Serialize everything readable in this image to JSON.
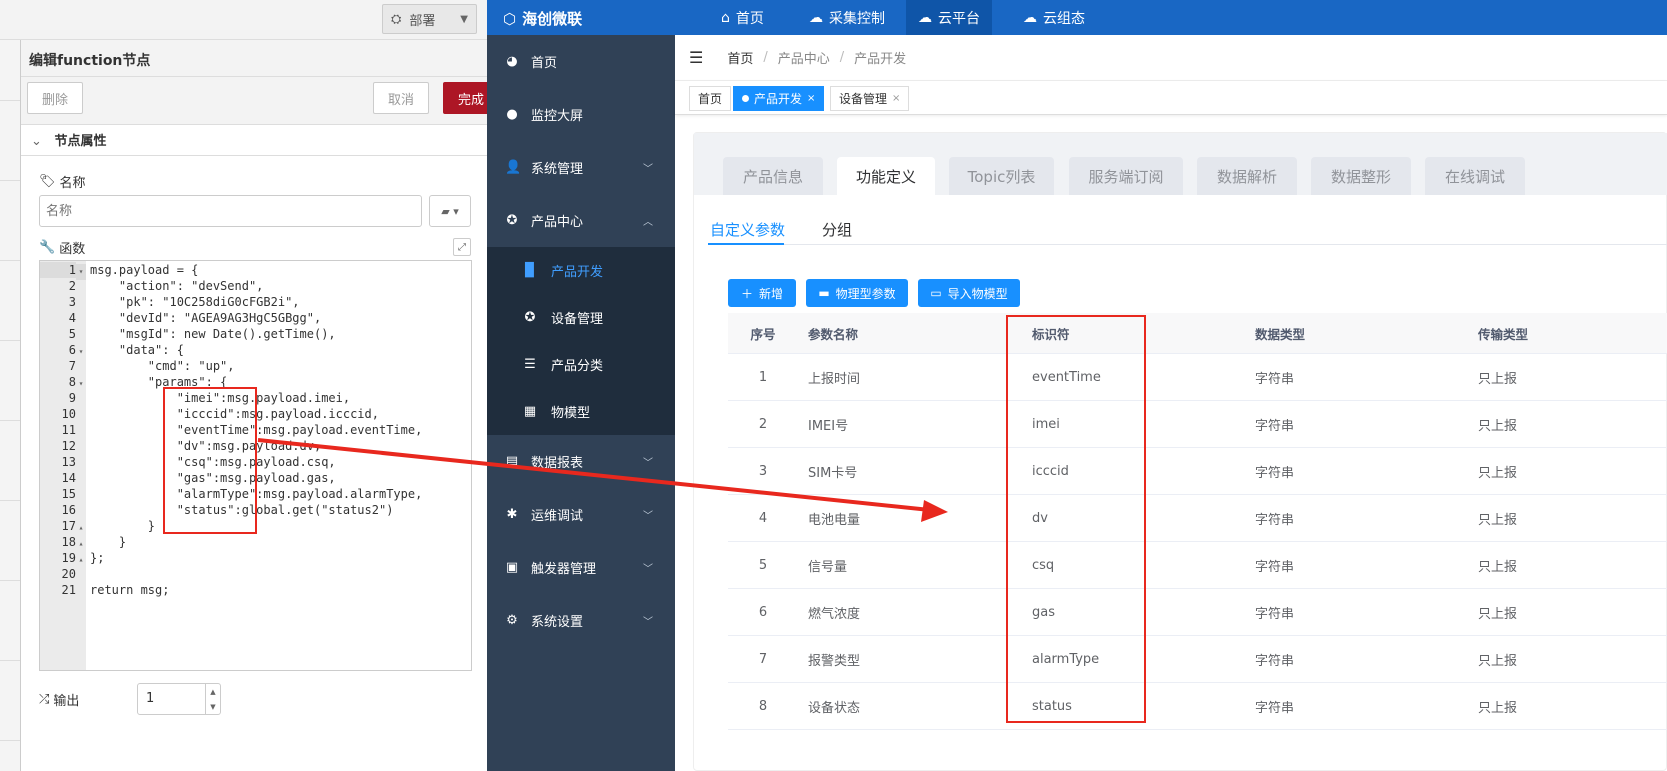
{
  "node_red": {
    "deploy_label": "部署",
    "panel_title": "编辑function节点",
    "delete_label": "删除",
    "cancel_label": "取消",
    "done_label": "完成",
    "section_label": "节点属性",
    "name_label": "名称",
    "name_placeholder": "名称",
    "function_label": "函数",
    "output_label": "输出",
    "output_value": "1",
    "code_lines": [
      {
        "n": "1",
        "fold": "▾",
        "text": "msg.payload = {"
      },
      {
        "n": "2",
        "fold": "",
        "text": "    \"action\": \"devSend\","
      },
      {
        "n": "3",
        "fold": "",
        "text": "    \"pk\": \"10C258diG0cFGB2i\","
      },
      {
        "n": "4",
        "fold": "",
        "text": "    \"devId\": \"AGEA9AG3HgC5GBgg\","
      },
      {
        "n": "5",
        "fold": "",
        "text": "    \"msgId\": new Date().getTime(),"
      },
      {
        "n": "6",
        "fold": "▾",
        "text": "    \"data\": {"
      },
      {
        "n": "7",
        "fold": "",
        "text": "        \"cmd\": \"up\","
      },
      {
        "n": "8",
        "fold": "▾",
        "text": "        \"params\": {"
      },
      {
        "n": "9",
        "fold": "",
        "text": "            \"imei\":msg.payload.imei,"
      },
      {
        "n": "10",
        "fold": "",
        "text": "            \"icccid\":msg.payload.icccid,"
      },
      {
        "n": "11",
        "fold": "",
        "text": "            \"eventTime\":msg.payload.eventTime,"
      },
      {
        "n": "12",
        "fold": "",
        "text": "            \"dv\":msg.payload.dv,"
      },
      {
        "n": "13",
        "fold": "",
        "text": "            \"csq\":msg.payload.csq,"
      },
      {
        "n": "14",
        "fold": "",
        "text": "            \"gas\":msg.payload.gas,"
      },
      {
        "n": "15",
        "fold": "",
        "text": "            \"alarmType\":msg.payload.alarmType,"
      },
      {
        "n": "16",
        "fold": "",
        "text": "            \"status\":global.get(\"status2\")"
      },
      {
        "n": "17",
        "fold": "▴",
        "text": "        }"
      },
      {
        "n": "18",
        "fold": "▴",
        "text": "    }"
      },
      {
        "n": "19",
        "fold": "▴",
        "text": "};"
      },
      {
        "n": "20",
        "fold": "",
        "text": ""
      },
      {
        "n": "21",
        "fold": "",
        "text": "return msg;"
      }
    ]
  },
  "app": {
    "logo": "海创微联",
    "top_nav": [
      {
        "label": "首页",
        "icon": "home-icon"
      },
      {
        "label": "采集控制",
        "icon": "cloud-gear-icon"
      },
      {
        "label": "云平台",
        "icon": "cloud-icon"
      },
      {
        "label": "云组态",
        "icon": "cloud-link-icon"
      }
    ],
    "sidebar": [
      {
        "label": "首页",
        "icon": "dashboard-icon"
      },
      {
        "label": "监控大屏",
        "icon": "globe-icon"
      },
      {
        "label": "系统管理",
        "icon": "user-icon"
      },
      {
        "label": "产品中心",
        "icon": "target-icon"
      },
      {
        "label": "数据报表",
        "icon": "report-icon"
      },
      {
        "label": "运维调试",
        "icon": "bug-icon"
      },
      {
        "label": "触发器管理",
        "icon": "trigger-icon"
      },
      {
        "label": "系统设置",
        "icon": "settings-icon"
      }
    ],
    "sidebar_sub": [
      {
        "label": "产品开发",
        "icon": "folder-icon"
      },
      {
        "label": "设备管理",
        "icon": "device-icon"
      },
      {
        "label": "产品分类",
        "icon": "list-icon"
      },
      {
        "label": "物模型",
        "icon": "grid-icon"
      }
    ],
    "breadcrumb": [
      "首页",
      "产品中心",
      "产品开发"
    ],
    "tags": [
      {
        "label": "首页"
      },
      {
        "label": "产品开发"
      },
      {
        "label": "设备管理"
      }
    ],
    "tabs": [
      "产品信息",
      "功能定义",
      "Topic列表",
      "服务端订阅",
      "数据解析",
      "数据整形",
      "在线调试"
    ],
    "sub_tabs": [
      "自定义参数",
      "分组"
    ],
    "actions": [
      "新增",
      "物理型参数",
      "导入物模型"
    ],
    "table": {
      "headers": [
        "序号",
        "参数名称",
        "标识符",
        "数据类型",
        "传输类型"
      ],
      "rows": [
        [
          "1",
          "上报时间",
          "eventTime",
          "字符串",
          "只上报"
        ],
        [
          "2",
          "IMEI号",
          "imei",
          "字符串",
          "只上报"
        ],
        [
          "3",
          "SIM卡号",
          "icccid",
          "字符串",
          "只上报"
        ],
        [
          "4",
          "电池电量",
          "dv",
          "字符串",
          "只上报"
        ],
        [
          "5",
          "信号量",
          "csq",
          "字符串",
          "只上报"
        ],
        [
          "6",
          "燃气浓度",
          "gas",
          "字符串",
          "只上报"
        ],
        [
          "7",
          "报警类型",
          "alarmType",
          "字符串",
          "只上报"
        ],
        [
          "8",
          "设备状态",
          "status",
          "字符串",
          "只上报"
        ]
      ]
    }
  },
  "colors": {
    "app_blue": "#1967c4",
    "sidebar": "#304156",
    "accent": "#1890ff",
    "annotation_red": "#e8281e",
    "done_button": "#ad1625"
  }
}
